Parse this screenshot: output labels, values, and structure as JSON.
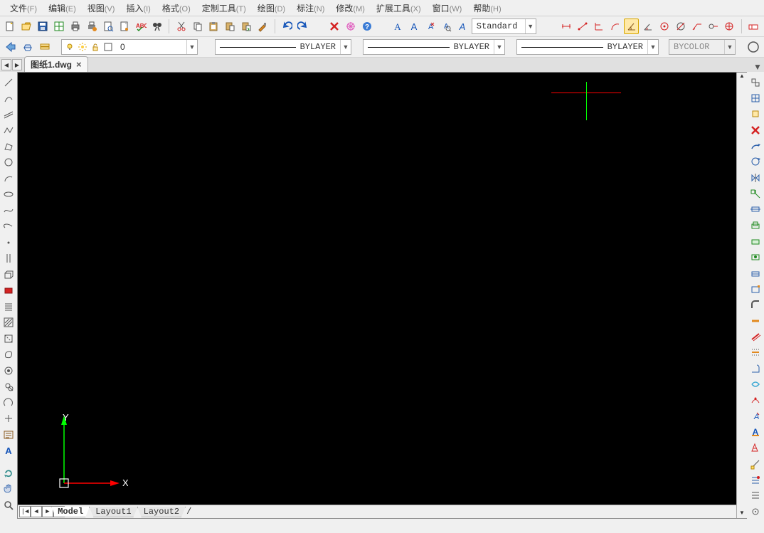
{
  "menu": [
    {
      "label": "文件",
      "hot": "(F)"
    },
    {
      "label": "编辑",
      "hot": "(E)"
    },
    {
      "label": "视图",
      "hot": "(V)"
    },
    {
      "label": "插入",
      "hot": "(I)"
    },
    {
      "label": "格式",
      "hot": "(O)"
    },
    {
      "label": "定制工具",
      "hot": "(T)"
    },
    {
      "label": "绘图",
      "hot": "(D)"
    },
    {
      "label": "标注",
      "hot": "(N)"
    },
    {
      "label": "修改",
      "hot": "(M)"
    },
    {
      "label": "扩展工具",
      "hot": "(X)"
    },
    {
      "label": "窗口",
      "hot": "(W)"
    },
    {
      "label": "帮助",
      "hot": "(H)"
    }
  ],
  "toolbar1_icons": [
    "new-file",
    "open-file",
    "save",
    "table-export",
    "print",
    "plot",
    "print-preview",
    "page-preview",
    "spellcheck",
    "find",
    "sep",
    "cut",
    "copy",
    "clipboard",
    "paste",
    "match-properties",
    "brush",
    "sep",
    "undo",
    "redo",
    "gap",
    "delete",
    "debug",
    "help"
  ],
  "text_style_combo": "Standard",
  "text_tool_icons": [
    "text-A",
    "text-A-underline",
    "text-Ax",
    "text-Aa",
    "text-Ai"
  ],
  "dimension_icons": [
    "dim-linear",
    "dim-aligned",
    "dim-chain",
    "dim-arc",
    "dim-angle",
    "dim-radius",
    "dim-diameter",
    "dim-center",
    "dim-leader",
    "dim-ordinate",
    "dim-tol",
    "dim-edit"
  ],
  "row3": {
    "layer_tool_icons": [
      "layer-prev",
      "layer-freeze",
      "layer-manager"
    ],
    "layer_state_icons": [
      "bulb-on",
      "sun",
      "lock-open",
      "color-swatch"
    ],
    "layer_combo": "0",
    "linetype_combo": "BYLAYER",
    "lineweight_combo": "BYLAYER",
    "plotstyle_combo": "BYLAYER",
    "color_combo": "BYCOLOR"
  },
  "doc_tab": {
    "title": "图纸1.dwg"
  },
  "left_tools": [
    "line",
    "arc-tool",
    "construction-line",
    "polyline",
    "polygon",
    "rectangle",
    "circle",
    "spline",
    "ellipse",
    "ellipse-arc",
    "point",
    "divide",
    "box-3d",
    "wedge-3d",
    "cone-3d",
    "hatch",
    "region",
    "boundary",
    "donut",
    "revision-cloud",
    "wipeout",
    "gradient",
    "mtext",
    "dtext",
    "blank",
    "regen",
    "pan",
    "zoom",
    "blank"
  ],
  "right_tools": [
    "prop-match",
    "layer-state",
    "isolate",
    "delete-x",
    "move",
    "rotate",
    "mirror",
    "scale",
    "stretch",
    "trim",
    "extend",
    "break",
    "join",
    "chamfer",
    "fillet",
    "explode",
    "offset",
    "array",
    "align",
    "lengthen",
    "edit-polyline",
    "edit-spline",
    "edit-hatch",
    "edit-text",
    "measure-dist",
    "measure-area",
    "list",
    "id-point"
  ],
  "canvas": {
    "crosshair": {
      "x_pct": 79,
      "y_pct": 5
    },
    "ucs": {
      "x_label": "X",
      "y_label": "Y"
    }
  },
  "layout_tabs": {
    "nav": [
      "|◀",
      "◀",
      "▶",
      "▶|"
    ],
    "tabs": [
      {
        "label": "Model",
        "active": true
      },
      {
        "label": "Layout1",
        "active": false
      },
      {
        "label": "Layout2",
        "active": false
      }
    ]
  }
}
